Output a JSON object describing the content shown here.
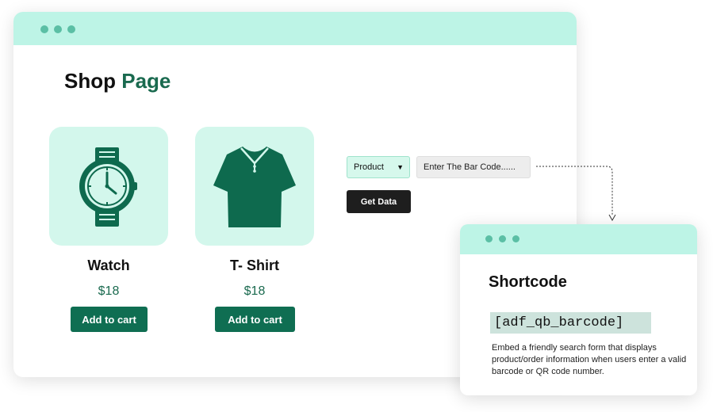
{
  "page": {
    "title_part1": "Shop",
    "title_part2": "Page"
  },
  "products": [
    {
      "name": "Watch",
      "price": "$18",
      "button_label": "Add to cart",
      "icon": "watch-icon"
    },
    {
      "name": "T- Shirt",
      "price": "$18",
      "button_label": "Add to cart",
      "icon": "tshirt-icon"
    }
  ],
  "search_form": {
    "type_select_value": "Product",
    "barcode_placeholder": "Enter The Bar Code......",
    "submit_label": "Get Data"
  },
  "shortcode_card": {
    "title": "Shortcode",
    "code": "[adf_qb_barcode]",
    "description": "Embed a friendly search form that displays product/order information when users enter a valid barcode or QR code number."
  },
  "colors": {
    "titlebar": "#bdf4e6",
    "accent_green": "#1a6a4f",
    "button_green": "#0f6e52",
    "card_bg": "#d3f7ec",
    "dark_button": "#1e1e1e"
  }
}
